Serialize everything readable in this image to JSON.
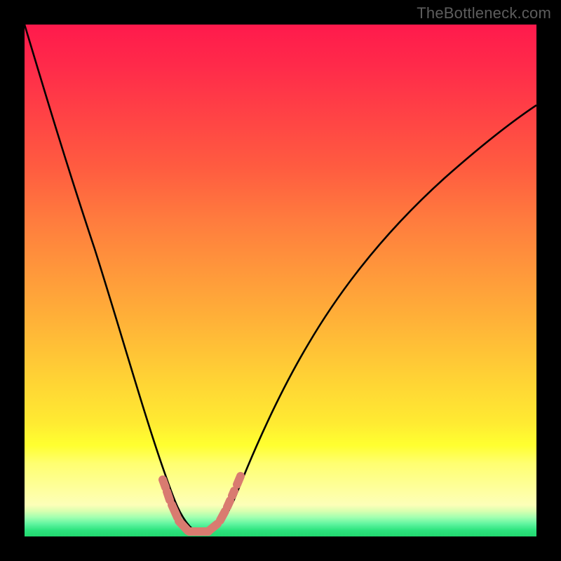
{
  "watermark": "TheBottleneck.com",
  "chart_data": {
    "type": "line",
    "title": "",
    "xlabel": "",
    "ylabel": "",
    "ylim": [
      0,
      100
    ],
    "xlim": [
      0,
      100
    ],
    "series": [
      {
        "name": "bottleneck-curve",
        "x": [
          0,
          5,
          10,
          15,
          20,
          25,
          28,
          30,
          32,
          34,
          36,
          38,
          40,
          45,
          50,
          55,
          60,
          70,
          80,
          90,
          100
        ],
        "values": [
          100,
          84,
          67,
          50,
          33,
          15,
          6,
          2,
          0,
          0,
          0,
          2,
          5,
          15,
          27,
          37,
          45,
          58,
          67,
          73,
          78
        ]
      }
    ],
    "annotations": [
      {
        "name": "green-good-zone",
        "y_range": [
          0,
          6
        ]
      },
      {
        "name": "yellow-ok-zone",
        "y_range": [
          6,
          18
        ]
      },
      {
        "name": "red-bad-zone",
        "y_range": [
          18,
          100
        ]
      }
    ],
    "markers": {
      "name": "sample-points",
      "color": "#d97b70",
      "points_xy": [
        [
          26.6,
          10.5
        ],
        [
          27.1,
          8.0
        ],
        [
          28.2,
          4.5
        ],
        [
          29.3,
          2.2
        ],
        [
          30.0,
          1.0
        ],
        [
          31.0,
          0.4
        ],
        [
          32.5,
          0.3
        ],
        [
          34.0,
          0.3
        ],
        [
          35.4,
          0.3
        ],
        [
          36.6,
          1.0
        ],
        [
          38.0,
          3.0
        ],
        [
          39.0,
          5.0
        ],
        [
          39.7,
          6.8
        ],
        [
          40.3,
          8.2
        ],
        [
          41.3,
          10.8
        ]
      ]
    }
  }
}
